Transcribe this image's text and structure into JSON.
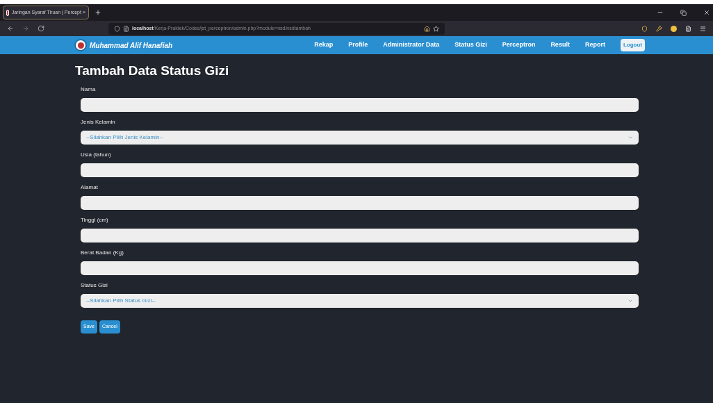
{
  "browser": {
    "tab_title": "Jaringan Syaraf Tiruan | Percept ×",
    "url_host": "localhost",
    "url_path": "/Kerja-Praktek/Codes/jst_perceptron/admin.php?module=nsd/nsdtambah"
  },
  "navbar": {
    "brand": "Muhammad Alif Hanafiah",
    "links": [
      {
        "label": "Rekap",
        "kind": "link"
      },
      {
        "label": "Profile",
        "kind": "link"
      },
      {
        "label": "Administrator Data",
        "kind": "link"
      },
      {
        "label": "Status Gizi",
        "kind": "link"
      },
      {
        "label": "Perceptron",
        "kind": "link"
      },
      {
        "label": "Result",
        "kind": "link"
      },
      {
        "label": "Report",
        "kind": "link"
      },
      {
        "label": "Logout",
        "kind": "button"
      }
    ]
  },
  "form": {
    "title": "Tambah Data Status Gizi",
    "fields": [
      {
        "label": "Nama",
        "kind": "input"
      },
      {
        "label": "Jenis Kelamin",
        "kind": "select",
        "placeholder": "--Silahkan Pilih Jenis Kelamin--"
      },
      {
        "label": "Usia (tahun)",
        "kind": "input"
      },
      {
        "label": "Alamat",
        "kind": "input"
      },
      {
        "label": "Tinggi (cm)",
        "kind": "input"
      },
      {
        "label": "Berat Badan (Kg)",
        "kind": "input"
      },
      {
        "label": "Status Gizi",
        "kind": "select",
        "placeholder": "--Silahkan Pilih Status Gizi--"
      }
    ],
    "buttons": [
      "Save",
      "Cancel"
    ]
  }
}
